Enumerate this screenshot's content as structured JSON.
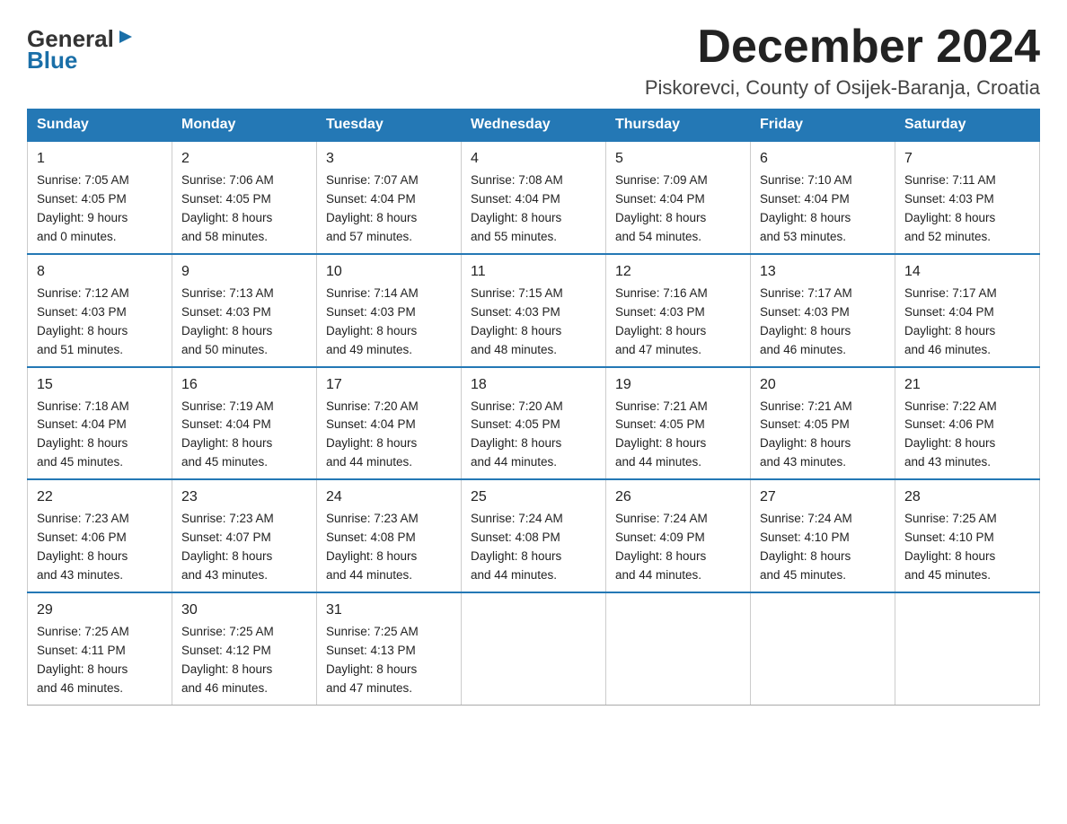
{
  "logo": {
    "general": "General",
    "blue": "Blue",
    "arrow": "▶"
  },
  "title": "December 2024",
  "subtitle": "Piskorevci, County of Osijek-Baranja, Croatia",
  "days_header": [
    "Sunday",
    "Monday",
    "Tuesday",
    "Wednesday",
    "Thursday",
    "Friday",
    "Saturday"
  ],
  "weeks": [
    [
      {
        "day": "1",
        "sunrise": "7:05 AM",
        "sunset": "4:05 PM",
        "daylight": "9 hours and 0 minutes."
      },
      {
        "day": "2",
        "sunrise": "7:06 AM",
        "sunset": "4:05 PM",
        "daylight": "8 hours and 58 minutes."
      },
      {
        "day": "3",
        "sunrise": "7:07 AM",
        "sunset": "4:04 PM",
        "daylight": "8 hours and 57 minutes."
      },
      {
        "day": "4",
        "sunrise": "7:08 AM",
        "sunset": "4:04 PM",
        "daylight": "8 hours and 55 minutes."
      },
      {
        "day": "5",
        "sunrise": "7:09 AM",
        "sunset": "4:04 PM",
        "daylight": "8 hours and 54 minutes."
      },
      {
        "day": "6",
        "sunrise": "7:10 AM",
        "sunset": "4:04 PM",
        "daylight": "8 hours and 53 minutes."
      },
      {
        "day": "7",
        "sunrise": "7:11 AM",
        "sunset": "4:03 PM",
        "daylight": "8 hours and 52 minutes."
      }
    ],
    [
      {
        "day": "8",
        "sunrise": "7:12 AM",
        "sunset": "4:03 PM",
        "daylight": "8 hours and 51 minutes."
      },
      {
        "day": "9",
        "sunrise": "7:13 AM",
        "sunset": "4:03 PM",
        "daylight": "8 hours and 50 minutes."
      },
      {
        "day": "10",
        "sunrise": "7:14 AM",
        "sunset": "4:03 PM",
        "daylight": "8 hours and 49 minutes."
      },
      {
        "day": "11",
        "sunrise": "7:15 AM",
        "sunset": "4:03 PM",
        "daylight": "8 hours and 48 minutes."
      },
      {
        "day": "12",
        "sunrise": "7:16 AM",
        "sunset": "4:03 PM",
        "daylight": "8 hours and 47 minutes."
      },
      {
        "day": "13",
        "sunrise": "7:17 AM",
        "sunset": "4:03 PM",
        "daylight": "8 hours and 46 minutes."
      },
      {
        "day": "14",
        "sunrise": "7:17 AM",
        "sunset": "4:04 PM",
        "daylight": "8 hours and 46 minutes."
      }
    ],
    [
      {
        "day": "15",
        "sunrise": "7:18 AM",
        "sunset": "4:04 PM",
        "daylight": "8 hours and 45 minutes."
      },
      {
        "day": "16",
        "sunrise": "7:19 AM",
        "sunset": "4:04 PM",
        "daylight": "8 hours and 45 minutes."
      },
      {
        "day": "17",
        "sunrise": "7:20 AM",
        "sunset": "4:04 PM",
        "daylight": "8 hours and 44 minutes."
      },
      {
        "day": "18",
        "sunrise": "7:20 AM",
        "sunset": "4:05 PM",
        "daylight": "8 hours and 44 minutes."
      },
      {
        "day": "19",
        "sunrise": "7:21 AM",
        "sunset": "4:05 PM",
        "daylight": "8 hours and 44 minutes."
      },
      {
        "day": "20",
        "sunrise": "7:21 AM",
        "sunset": "4:05 PM",
        "daylight": "8 hours and 43 minutes."
      },
      {
        "day": "21",
        "sunrise": "7:22 AM",
        "sunset": "4:06 PM",
        "daylight": "8 hours and 43 minutes."
      }
    ],
    [
      {
        "day": "22",
        "sunrise": "7:23 AM",
        "sunset": "4:06 PM",
        "daylight": "8 hours and 43 minutes."
      },
      {
        "day": "23",
        "sunrise": "7:23 AM",
        "sunset": "4:07 PM",
        "daylight": "8 hours and 43 minutes."
      },
      {
        "day": "24",
        "sunrise": "7:23 AM",
        "sunset": "4:08 PM",
        "daylight": "8 hours and 44 minutes."
      },
      {
        "day": "25",
        "sunrise": "7:24 AM",
        "sunset": "4:08 PM",
        "daylight": "8 hours and 44 minutes."
      },
      {
        "day": "26",
        "sunrise": "7:24 AM",
        "sunset": "4:09 PM",
        "daylight": "8 hours and 44 minutes."
      },
      {
        "day": "27",
        "sunrise": "7:24 AM",
        "sunset": "4:10 PM",
        "daylight": "8 hours and 45 minutes."
      },
      {
        "day": "28",
        "sunrise": "7:25 AM",
        "sunset": "4:10 PM",
        "daylight": "8 hours and 45 minutes."
      }
    ],
    [
      {
        "day": "29",
        "sunrise": "7:25 AM",
        "sunset": "4:11 PM",
        "daylight": "8 hours and 46 minutes."
      },
      {
        "day": "30",
        "sunrise": "7:25 AM",
        "sunset": "4:12 PM",
        "daylight": "8 hours and 46 minutes."
      },
      {
        "day": "31",
        "sunrise": "7:25 AM",
        "sunset": "4:13 PM",
        "daylight": "8 hours and 47 minutes."
      },
      null,
      null,
      null,
      null
    ]
  ],
  "labels": {
    "sunrise": "Sunrise:",
    "sunset": "Sunset:",
    "daylight": "Daylight:"
  },
  "colors": {
    "header_bg": "#2478b5",
    "header_text": "#ffffff",
    "border": "#aaaaaa"
  }
}
